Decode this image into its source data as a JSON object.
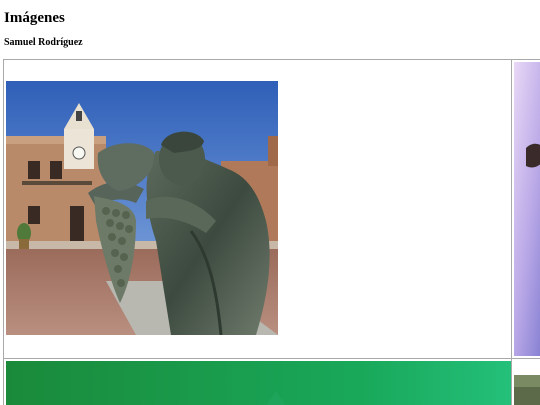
{
  "page": {
    "title": "Imágenes",
    "author": "Samuel Rodríguez"
  },
  "gallery": {
    "images": [
      {
        "icon": "statue-photo",
        "description_visible": false
      },
      {
        "icon": "photo-thumbnail-purple",
        "description_visible": false
      },
      {
        "icon": "photo-thumbnail-green",
        "description_visible": false
      },
      {
        "icon": "photo-thumbnail-dark",
        "description_visible": false
      }
    ]
  },
  "colors": {
    "border": "#a9a9a9",
    "sky": "#3f6fc0",
    "green": "#1fb25a"
  }
}
